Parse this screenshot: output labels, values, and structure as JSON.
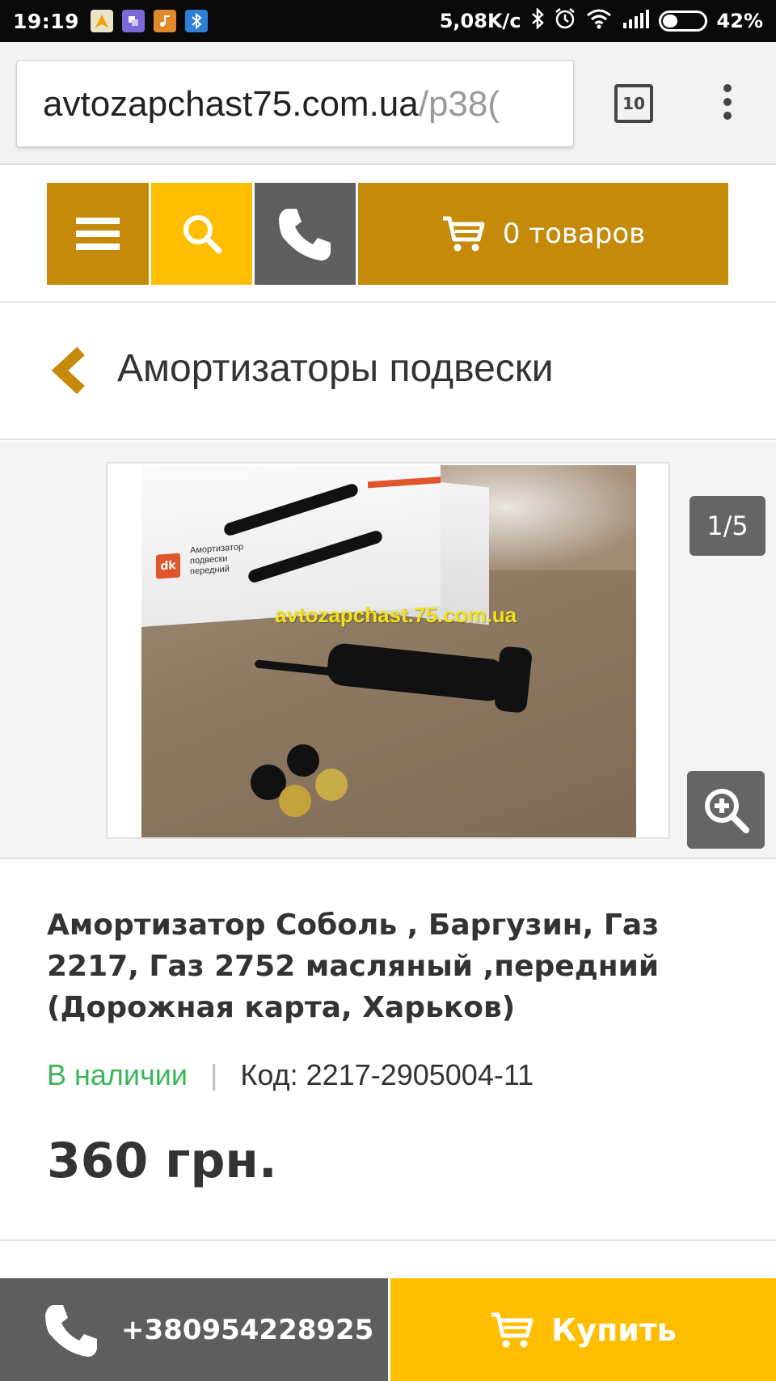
{
  "status_bar": {
    "time": "19:19",
    "network_speed": "5,08K/c",
    "battery_percent": "42%",
    "battery_level": 0.42
  },
  "browser": {
    "url_domain": "avtozapchast75.com.ua",
    "url_path": "/p38(",
    "tabs_count": "10"
  },
  "header": {
    "cart_label": "0 товаров",
    "colors": {
      "primary": "#c58a0a",
      "accent": "#ffbf00",
      "dark": "#5e5e5e"
    }
  },
  "category": {
    "title": "Амортизаторы подвески"
  },
  "gallery": {
    "counter": "1/5",
    "watermark": "avtozapchast.75.com.ua",
    "box_logo": "dk",
    "box_text": [
      "Амортизатор",
      "подвески",
      "передний"
    ]
  },
  "product": {
    "title": "Амортизатор Соболь , Баргузин, Газ 2217, Газ 2752 масляный ,передний (Дорожная карта, Харьков)",
    "stock_status": "В наличии",
    "separator": "|",
    "code_label": "Код:",
    "code_value": "2217-2905004-11",
    "price": "360 грн.",
    "stock_color": "#3cb55a"
  },
  "bottom_bar": {
    "phone": "+380954228925",
    "buy_label": "Купить"
  }
}
